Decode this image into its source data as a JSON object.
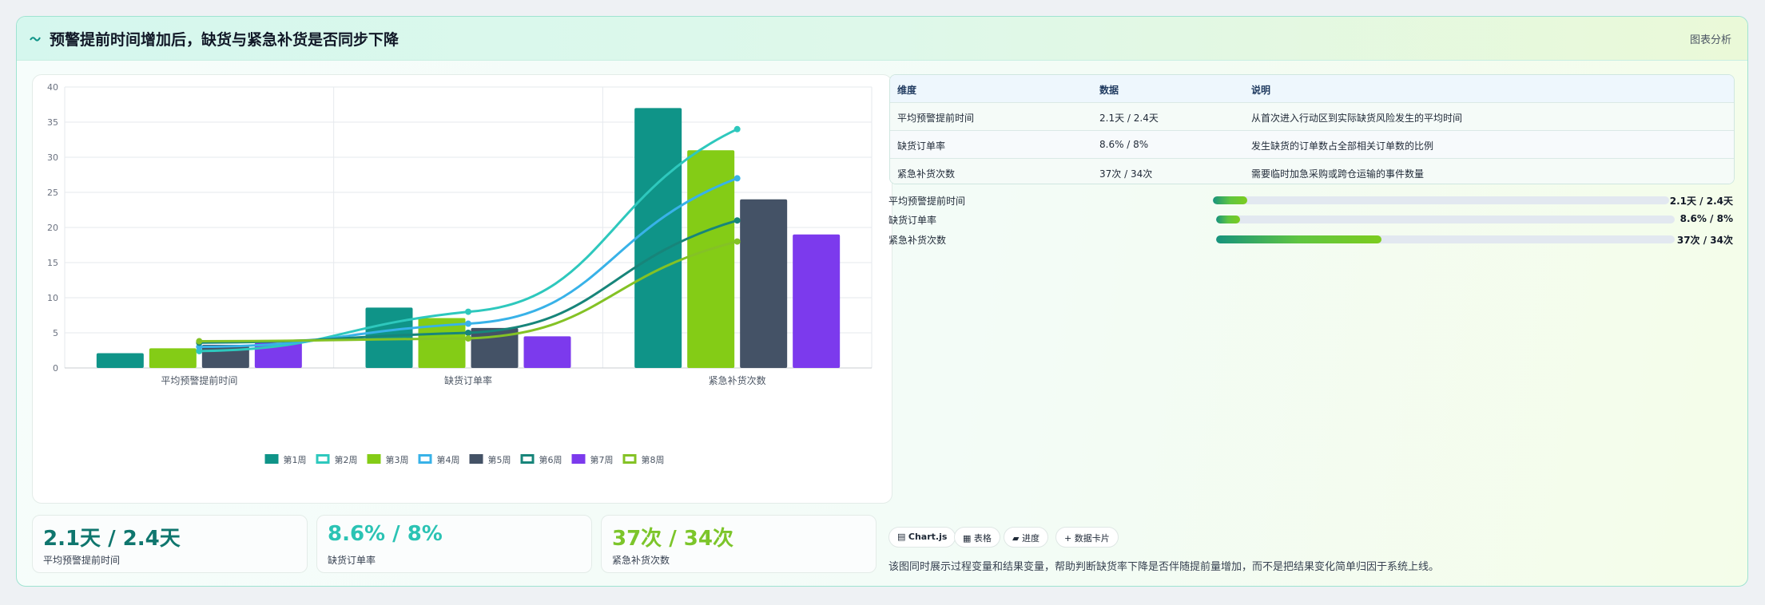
{
  "header": {
    "title": "预警提前时间增加后，缺货与紧急补货是否同步下降",
    "tag": "图表分析",
    "logo_icon": "chart-wave-icon"
  },
  "chart_data": {
    "type": "bar",
    "categories": [
      "平均预警提前时间",
      "缺货订单率",
      "紧急补货次数"
    ],
    "ylim": [
      0,
      40
    ],
    "yticks": [
      0,
      5,
      10,
      15,
      20,
      25,
      30,
      35,
      40
    ],
    "grid": true,
    "legend_position": "bottom",
    "series": [
      {
        "name": "第1周",
        "kind": "bar",
        "color": "#0f9488",
        "values": [
          2.1,
          8.6,
          37
        ]
      },
      {
        "name": "第2周",
        "kind": "line",
        "color": "#2ec8bd",
        "values": [
          2.4,
          8.0,
          34
        ]
      },
      {
        "name": "第3周",
        "kind": "bar",
        "color": "#84cc16",
        "values": [
          2.8,
          7.1,
          31
        ]
      },
      {
        "name": "第4周",
        "kind": "line",
        "color": "#38b2e8",
        "values": [
          3.0,
          6.3,
          27
        ]
      },
      {
        "name": "第5周",
        "kind": "bar",
        "color": "#445266",
        "values": [
          3.3,
          5.7,
          24
        ]
      },
      {
        "name": "第6周",
        "kind": "line",
        "color": "#17857a",
        "values": [
          3.6,
          5.0,
          21
        ]
      },
      {
        "name": "第7周",
        "kind": "bar",
        "color": "#7c3aed",
        "values": [
          3.6,
          4.5,
          19
        ]
      },
      {
        "name": "第8周",
        "kind": "line",
        "color": "#84c225",
        "values": [
          3.8,
          4.2,
          18
        ]
      }
    ]
  },
  "stats": [
    {
      "value": "2.1天 / 2.4天",
      "label": "平均预警提前时间",
      "color": "#0f766e"
    },
    {
      "value": "8.6% / 8%",
      "label": "缺货订单率",
      "color": "#2bc3b4"
    },
    {
      "value": "37次 / 34次",
      "label": "紧急补货次数",
      "color": "#7cc52a"
    }
  ],
  "table": {
    "headers": [
      "维度",
      "数据",
      "说明"
    ],
    "rows": [
      [
        "平均预警提前时间",
        "2.1天 / 2.4天",
        "从首次进入行动区到实际缺货风险发生的平均时间"
      ],
      [
        "缺货订单率",
        "8.6% / 8%",
        "发生缺货的订单数占全部相关订单数的比例"
      ],
      [
        "紧急补货次数",
        "37次 / 34次",
        "需要临时加急采购或跨仓运输的事件数量"
      ]
    ]
  },
  "progress": [
    {
      "label": "平均预警提前时间",
      "value": "2.1天 / 2.4天",
      "fraction": 0.075
    },
    {
      "label": "缺货订单率",
      "value": "8.6% / 8%",
      "fraction": 0.053
    },
    {
      "label": "紧急补货次数",
      "value": "37次 / 34次",
      "fraction": 0.36
    }
  ],
  "chips": [
    {
      "label": "Chart.js",
      "icon": "chart-icon"
    },
    {
      "label": "表格",
      "icon": "table-icon"
    },
    {
      "label": "进度",
      "icon": "progress-icon"
    },
    {
      "label": "数据卡片",
      "icon": "plus-icon"
    }
  ],
  "note": "该图同时展示过程变量和结果变量，帮助判断缺货率下降是否伴随提前量增加，而不是把结果变化简单归因于系统上线。"
}
